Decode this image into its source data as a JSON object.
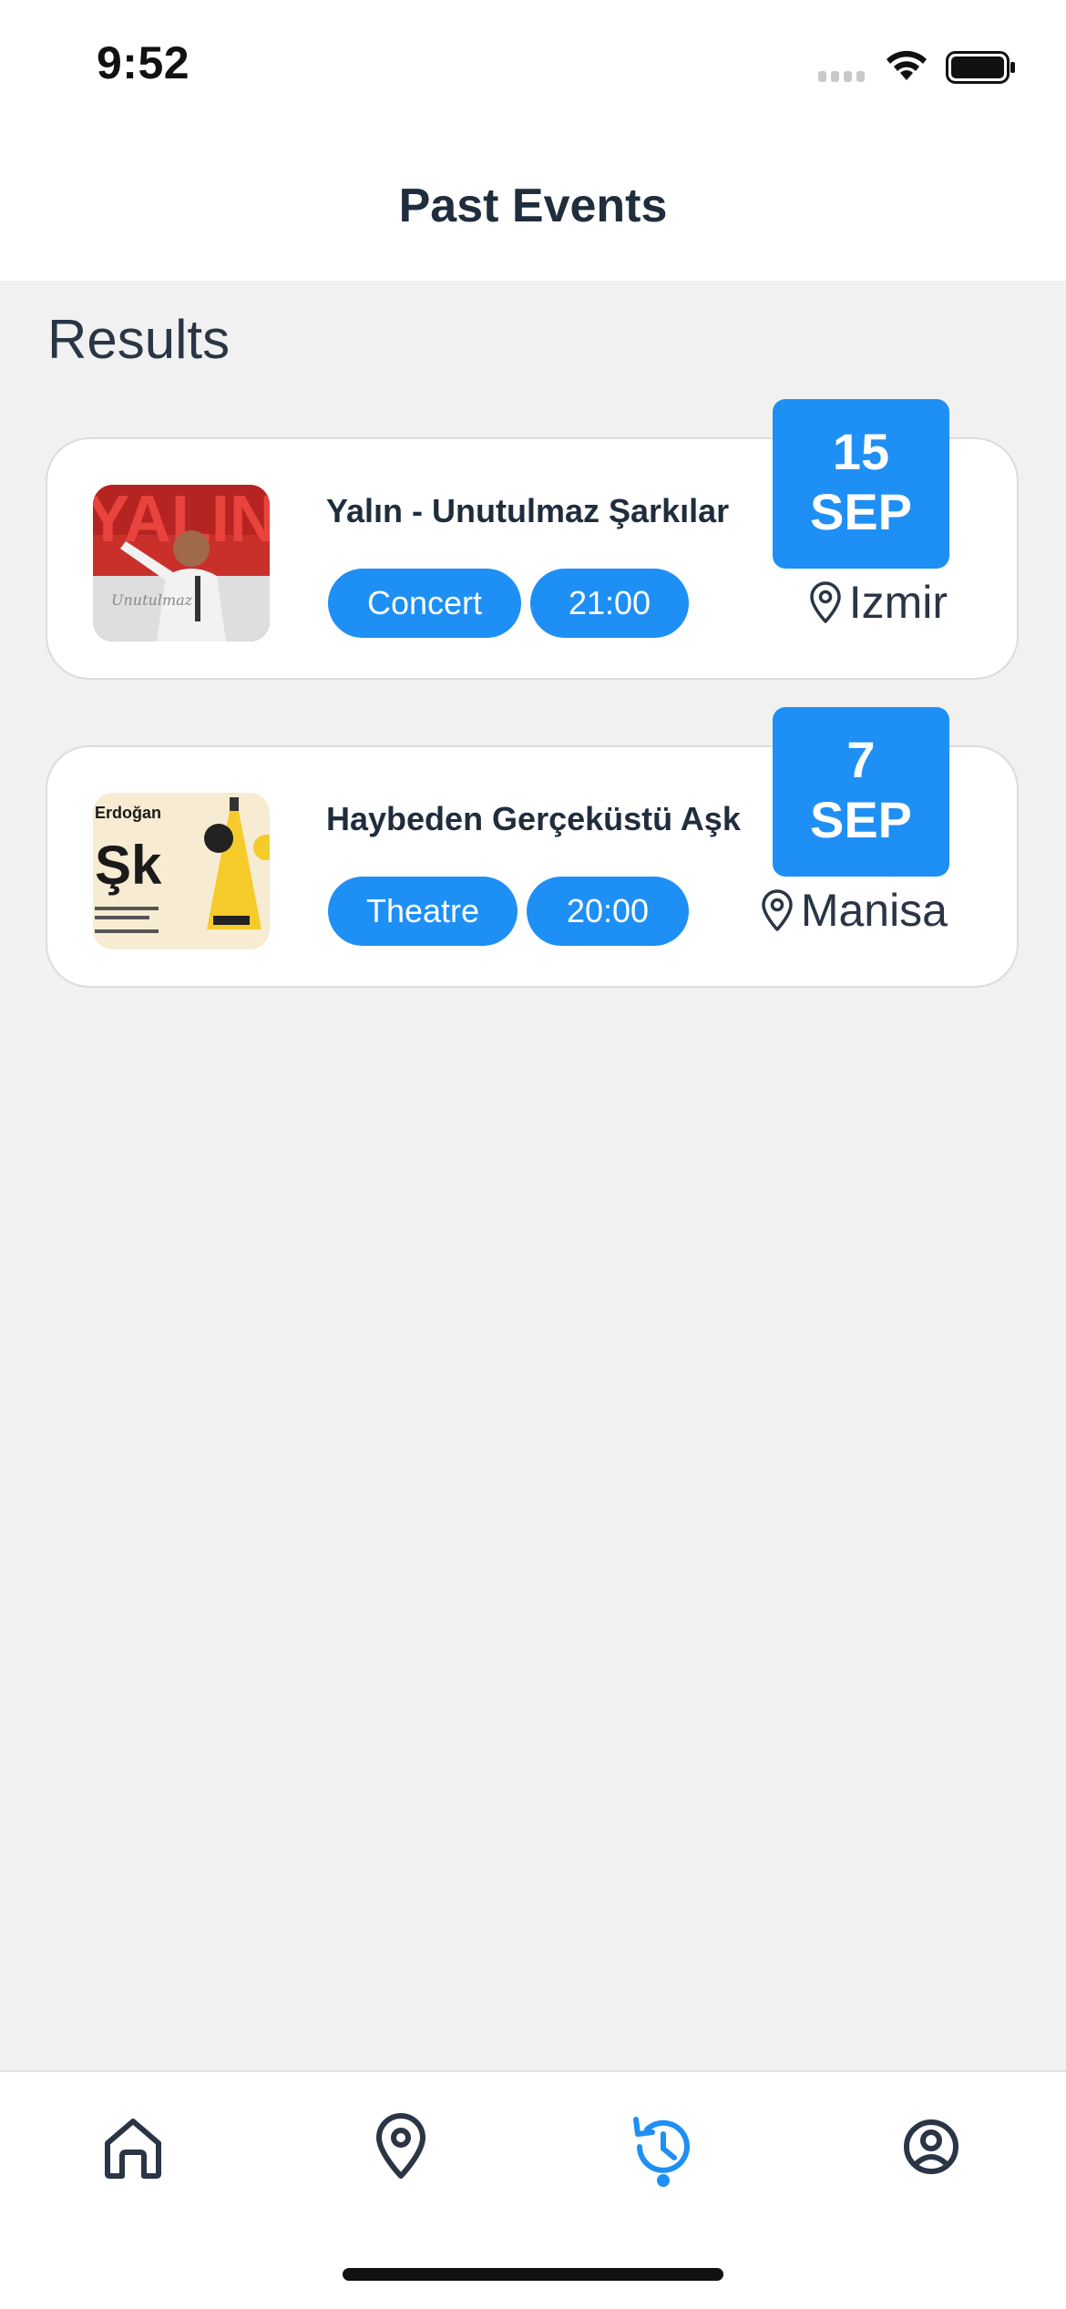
{
  "status_bar": {
    "time": "9:52"
  },
  "header": {
    "title": "Past Events"
  },
  "results": {
    "heading": "Results"
  },
  "events": [
    {
      "title": "Yalın - Unutulmaz Şarkılar",
      "category": "Concert",
      "time": "21:00",
      "day": "15",
      "month": "SEP",
      "location": "Izmir",
      "poster_text": "YALIN"
    },
    {
      "title": "Haybeden Gerçeküstü Aşk",
      "category": "Theatre",
      "time": "20:00",
      "day": "7",
      "month": "SEP",
      "location": "Manisa",
      "poster_text": "Erdoğan"
    }
  ],
  "tab_bar": {
    "items": [
      {
        "icon": "home-icon",
        "active": false
      },
      {
        "icon": "map-pin-icon",
        "active": false
      },
      {
        "icon": "history-icon",
        "active": true
      },
      {
        "icon": "profile-icon",
        "active": false
      }
    ]
  },
  "colors": {
    "accent": "#1e8ff5",
    "text_dark": "#1f2d3d",
    "background": "#f1f1f1",
    "card": "#ffffff"
  }
}
